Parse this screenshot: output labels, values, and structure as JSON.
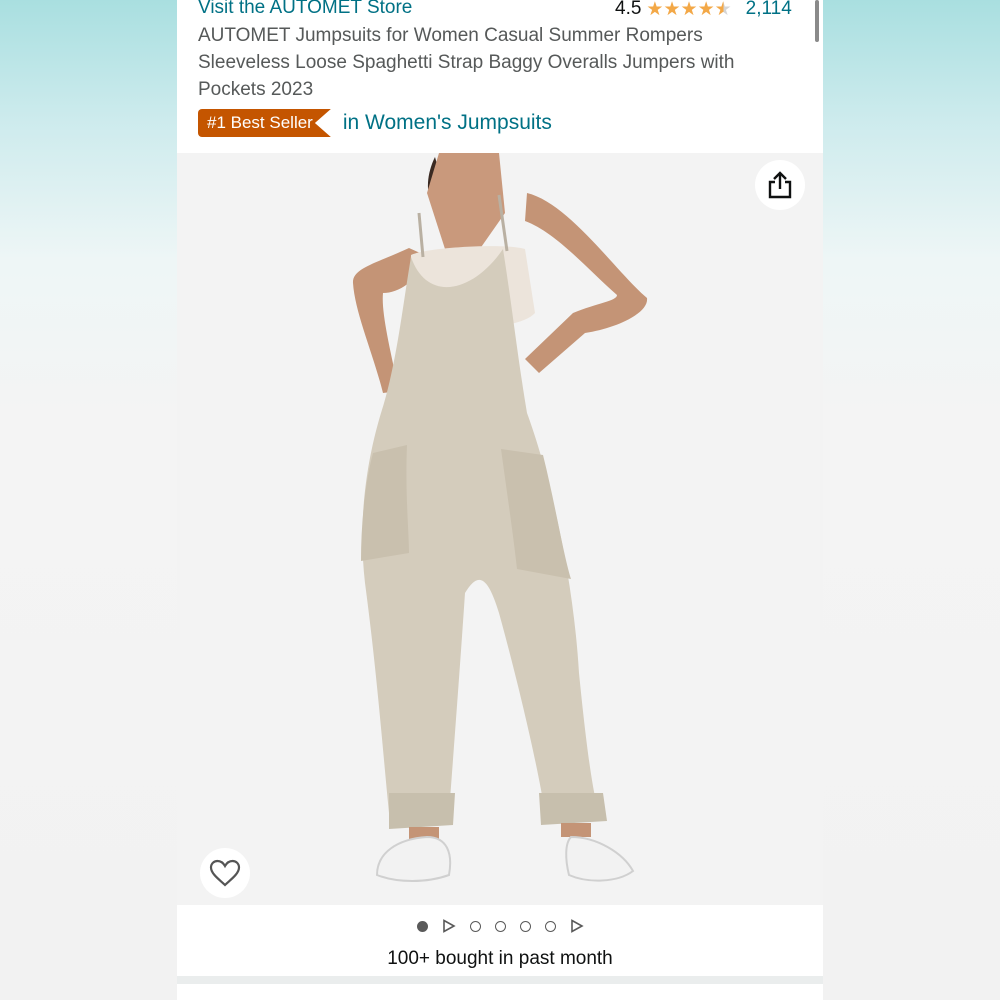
{
  "store": {
    "link_text": "Visit the AUTOMET Store"
  },
  "rating": {
    "value": "4.5",
    "stars": 4.5,
    "count": "2,114",
    "star_color": "#f3a847"
  },
  "product": {
    "title": "AUTOMET Jumpsuits for Women Casual Summer Rompers Sleeveless Loose Spaghetti Strap Baggy Overalls Jumpers with Pockets 2023"
  },
  "best_seller": {
    "badge": "#1 Best Seller",
    "category": "in Women's Jumpsuits",
    "badge_color": "#c45500"
  },
  "image": {
    "share_icon": "share-icon",
    "wishlist_icon": "heart-icon"
  },
  "carousel": {
    "items": [
      "dot",
      "play",
      "dot",
      "dot",
      "dot",
      "dot",
      "play"
    ],
    "active_index": 0
  },
  "purchase_info": {
    "bought_text": "100+ bought in past month"
  },
  "colors": {
    "link": "#007185",
    "text": "#0f1111",
    "secondary_text": "#565959"
  }
}
